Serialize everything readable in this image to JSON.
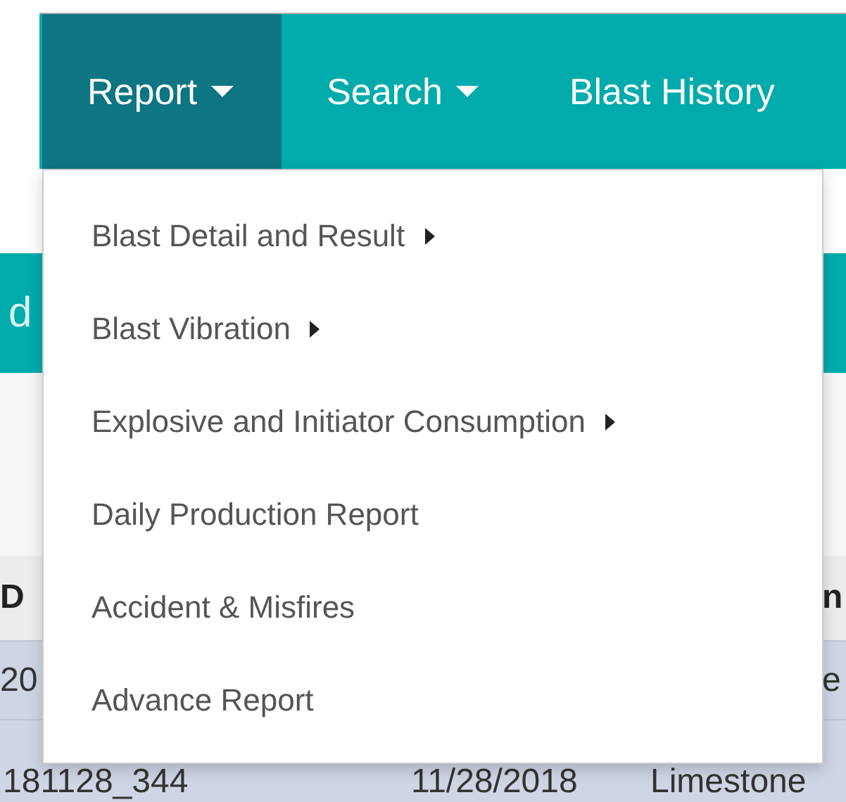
{
  "nav": {
    "items": [
      {
        "label": "Report",
        "dropdown": true,
        "selected": true
      },
      {
        "label": "Search",
        "dropdown": true,
        "selected": false
      },
      {
        "label": "Blast History",
        "dropdown": false,
        "selected": false
      }
    ]
  },
  "background": {
    "banner": "d",
    "table": {
      "header": [
        "D",
        "n"
      ],
      "rows": [
        {
          "cells": [
            "20",
            "e"
          ]
        },
        {
          "cells": [
            "181128_344",
            "11/28/2018",
            "Limestone"
          ]
        }
      ]
    }
  },
  "report_menu": {
    "items": [
      {
        "label": "Blast Detail and Result",
        "has_submenu": true
      },
      {
        "label": "Blast Vibration",
        "has_submenu": true
      },
      {
        "label": "Explosive and Initiator Consumption",
        "has_submenu": true
      },
      {
        "label": "Daily Production Report",
        "has_submenu": false
      },
      {
        "label": "Accident & Misfires",
        "has_submenu": false
      },
      {
        "label": "Advance Report",
        "has_submenu": false
      }
    ]
  }
}
